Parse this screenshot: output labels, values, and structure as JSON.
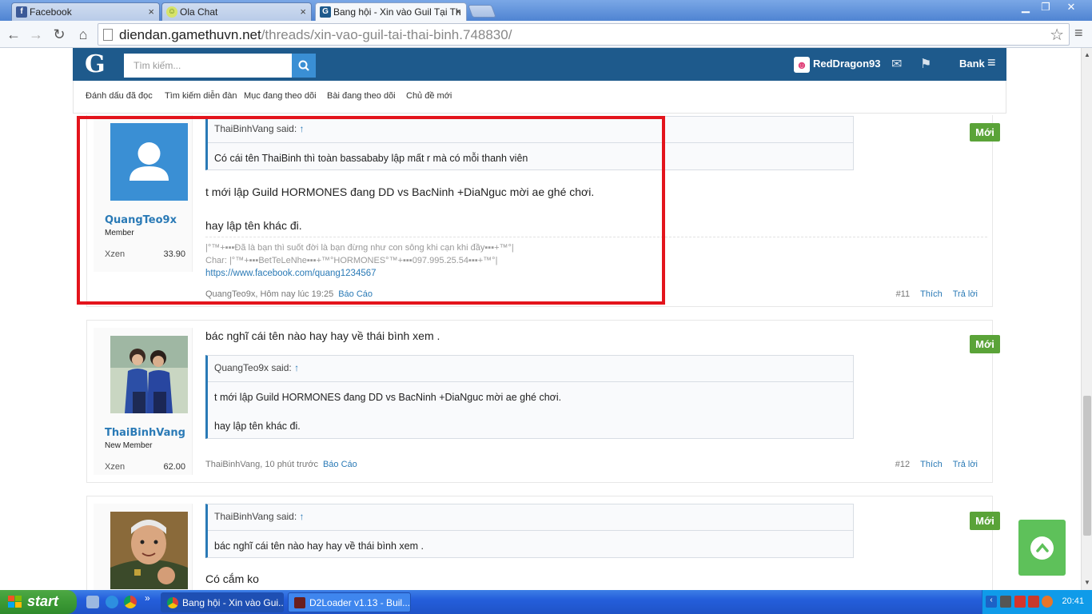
{
  "browser": {
    "tabs": [
      {
        "label": "Facebook",
        "icon": "facebook-icon",
        "color": "#3b5998"
      },
      {
        "label": "Ola Chat",
        "icon": "chat-icon",
        "color": "#9ac33b"
      },
      {
        "label": "Bang hội - Xin vào Guil Tại Th",
        "icon": "gamethu-icon",
        "color": "#1e5a8c"
      }
    ],
    "url_domain": "diendan.gamethuvn.net",
    "url_path": "/threads/xin-vao-guil-tai-thai-binh.748830/"
  },
  "site": {
    "logo": "G",
    "search_placeholder": "Tìm kiếm...",
    "user_name": "RedDragon93",
    "bank_label": "Bank",
    "subnav": [
      "Đánh dấu đã đọc",
      "Tìm kiếm diễn đàn",
      "Mục đang theo dõi",
      "Bài đang theo dõi",
      "Chủ đề mới"
    ]
  },
  "posts": [
    {
      "author": "QuangTeo9x",
      "user_title": "Member",
      "xzen_label": "Xzen",
      "xzen": "33.90",
      "quote_author": "ThaiBinhVang said:",
      "quote_arrow": "↑",
      "quote_text": "Có cái tên ThaiBinh thì toàn bassababy lập mất r mà có mỗi thanh viên",
      "message_line1": "t mới lập Guild HORMONES đang DD vs BacNinh +DiaNguc mời ae ghé chơi.",
      "message_line2": "hay lập tên khác đi.",
      "sig_line1": "|°™+▪▪▪Đã là bạn thì suốt đời là bạn đừng như con sông khi cạn khi đầy▪▪▪+™°|",
      "sig_line2": "Char: |°™+▪▪▪BetTeLeNhe▪▪▪+™°HORMONES°™+▪▪▪097.995.25.54▪▪▪+™°|",
      "sig_link": "https://www.facebook.com/quang1234567",
      "meta": "QuangTeo9x, Hôm nay lúc 19:25",
      "report": "Báo Cáo",
      "number": "#11",
      "like": "Thích",
      "reply": "Trả lời",
      "badge": "Mới"
    },
    {
      "author": "ThaiBinhVang",
      "user_title": "New Member",
      "xzen_label": "Xzen",
      "xzen": "62.00",
      "message_line1": "bác nghĩ cái tên nào hay hay về thái bình xem .",
      "quote_author": "QuangTeo9x said:",
      "quote_arrow": "↑",
      "quote_text1": "t mới lập Guild HORMONES đang DD vs BacNinh +DiaNguc mời ae ghé chơi.",
      "quote_text2": "hay lập tên khác đi.",
      "meta": "ThaiBinhVang, 10 phút trước",
      "report": "Báo Cáo",
      "number": "#12",
      "like": "Thích",
      "reply": "Trả lời",
      "badge": "Mới"
    },
    {
      "quote_author": "ThaiBinhVang said:",
      "quote_arrow": "↑",
      "quote_text": "bác nghĩ cái tên nào hay hay về thái bình xem .",
      "message_line1": "Có cắm ko",
      "badge": "Mới"
    }
  ],
  "taskbar": {
    "start_label": "start",
    "tasks": [
      "Bang hội - Xin vào Gui...",
      "D2Loader v1.13 - Buil..."
    ],
    "quicklaunch_more": "»",
    "clock": "20:41"
  }
}
